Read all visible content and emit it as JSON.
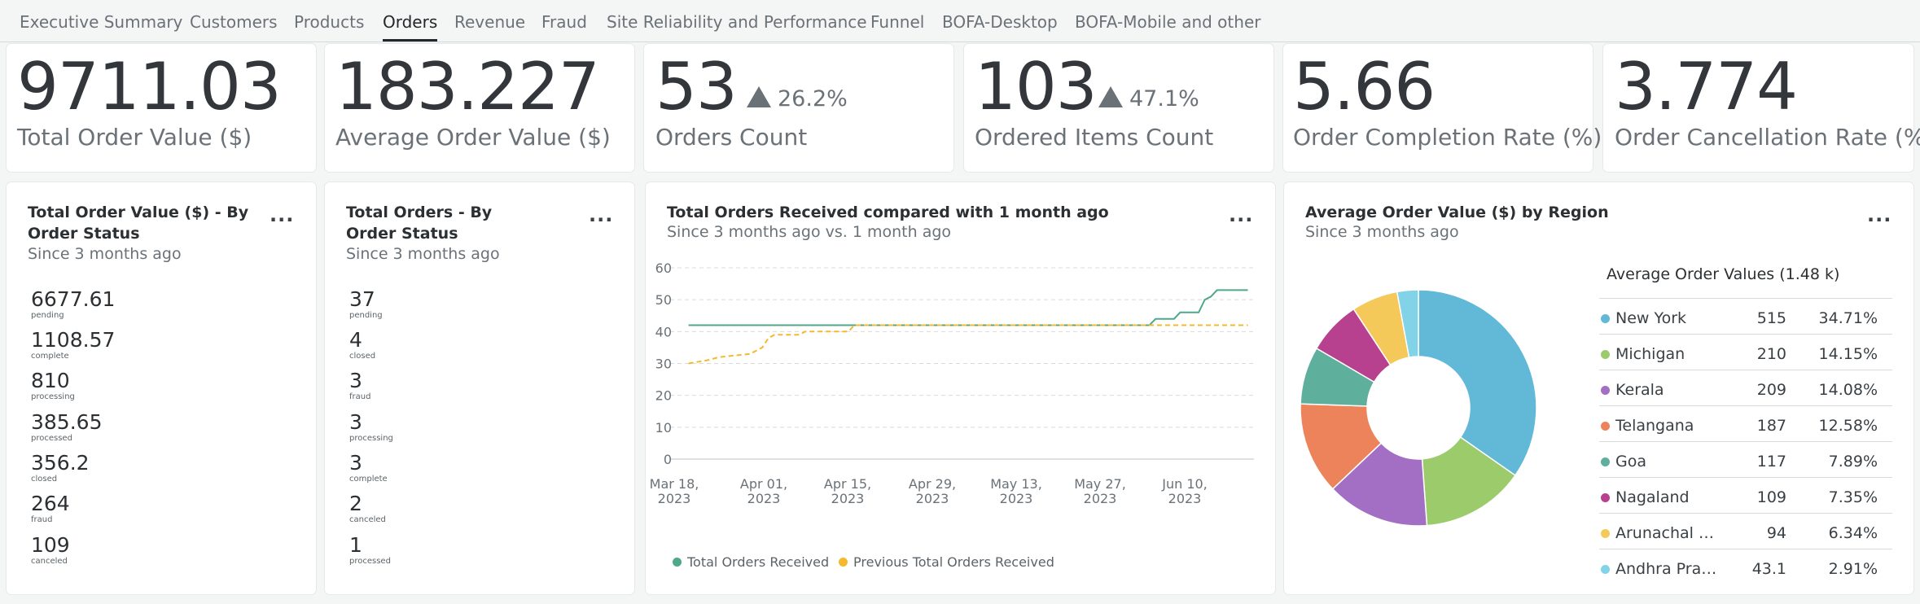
{
  "tabs": [
    {
      "label": "Executive Summary",
      "active": false
    },
    {
      "label": "Customers",
      "active": false
    },
    {
      "label": "Products",
      "active": false
    },
    {
      "label": "Orders",
      "active": true
    },
    {
      "label": "Revenue",
      "active": false
    },
    {
      "label": "Fraud",
      "active": false
    },
    {
      "label": "Site Reliability and Performance",
      "active": false
    },
    {
      "label": "Funnel",
      "active": false
    },
    {
      "label": "BOFA-Desktop",
      "active": false
    },
    {
      "label": "BOFA-Mobile and other",
      "active": false
    }
  ],
  "kpis": [
    {
      "value": "9711.03",
      "label": "Total Order Value ($)",
      "delta": ""
    },
    {
      "value": "183.227",
      "label": "Average Order Value ($)",
      "delta": ""
    },
    {
      "value": "53",
      "label": "Orders Count",
      "delta": "26.2%"
    },
    {
      "value": "103",
      "label": "Ordered Items Count",
      "delta": "47.1%"
    },
    {
      "value": "5.66",
      "label": "Order Completion Rate (%)",
      "delta": ""
    },
    {
      "value": "3.774",
      "label": "Order Cancellation Rate (%)",
      "delta": ""
    }
  ],
  "panels": {
    "order_value_status": {
      "title": "Total Order Value ($) - By Order Status",
      "subtitle": "Since 3 months ago",
      "menu": "...",
      "stats": [
        {
          "value": "6677.61",
          "label": "pending"
        },
        {
          "value": "1108.57",
          "label": "complete"
        },
        {
          "value": "810",
          "label": "processing"
        },
        {
          "value": "385.65",
          "label": "processed"
        },
        {
          "value": "356.2",
          "label": "closed"
        },
        {
          "value": "264",
          "label": "fraud"
        },
        {
          "value": "109",
          "label": "canceled"
        }
      ]
    },
    "orders_status": {
      "title": "Total Orders - By Order Status",
      "subtitle": "Since 3 months ago",
      "menu": "...",
      "stats": [
        {
          "value": "37",
          "label": "pending"
        },
        {
          "value": "4",
          "label": "closed"
        },
        {
          "value": "3",
          "label": "fraud"
        },
        {
          "value": "3",
          "label": "processing"
        },
        {
          "value": "3",
          "label": "complete"
        },
        {
          "value": "2",
          "label": "canceled"
        },
        {
          "value": "1",
          "label": "processed"
        }
      ]
    },
    "orders_compare": {
      "title": "Total Orders Received compared with 1 month ago",
      "subtitle": "Since 3 months ago vs. 1 month ago",
      "menu": "..."
    },
    "region": {
      "title": "Average Order Value ($) by Region",
      "subtitle": "Since 3 months ago",
      "menu": "...",
      "table_title": "Average Order Values (1.48 k)",
      "rows": [
        {
          "name": "New York",
          "value": "515",
          "pct": "34.71%",
          "color": "#62b8d7"
        },
        {
          "name": "Michigan",
          "value": "210",
          "pct": "14.15%",
          "color": "#9ccb6b"
        },
        {
          "name": "Kerala",
          "value": "209",
          "pct": "14.08%",
          "color": "#a36fc4"
        },
        {
          "name": "Telangana",
          "value": "187",
          "pct": "12.58%",
          "color": "#ec835b"
        },
        {
          "name": "Goa",
          "value": "117",
          "pct": "7.89%",
          "color": "#5eaf9b"
        },
        {
          "name": "Nagaland",
          "value": "109",
          "pct": "7.35%",
          "color": "#b8418f"
        },
        {
          "name": "Arunachal Pr...",
          "value": "94",
          "pct": "6.34%",
          "color": "#f4c95a"
        },
        {
          "name": "Andhra Prad...",
          "value": "43.1",
          "pct": "2.91%",
          "color": "#82d2e8"
        }
      ]
    }
  },
  "chart_data": [
    {
      "type": "line",
      "title": "Total Orders Received compared with 1 month ago",
      "ylim": [
        0,
        60
      ],
      "y_ticks": [
        "60",
        "50",
        "40",
        "30",
        "20",
        "10",
        "0"
      ],
      "x_ticks": [
        {
          "l1": "Mar 18,",
          "l2": "2023"
        },
        {
          "l1": "Apr 01,",
          "l2": "2023"
        },
        {
          "l1": "Apr 15,",
          "l2": "2023"
        },
        {
          "l1": "Apr 29,",
          "l2": "2023"
        },
        {
          "l1": "May 13,",
          "l2": "2023"
        },
        {
          "l1": "May 27,",
          "l2": "2023"
        },
        {
          "l1": "Jun 10,",
          "l2": "2023"
        }
      ],
      "x_ticks_printed": [
        "lar 18, 2023",
        "Apr 01, 2023",
        "Apr 15, 2023",
        "Apr 29, 2023",
        "May 13, 2023",
        "May 27, 2023",
        "Jun 10, 2023"
      ],
      "x_range": [
        "2023-03-18",
        "2023-06-21"
      ],
      "grid": true,
      "legend_position": "bottom-left",
      "series": [
        {
          "name": "Total Orders Received",
          "color": "#4fa88c",
          "dash": false,
          "points": [
            [
              "2023-03-21",
              42
            ],
            [
              "2023-06-04",
              42
            ],
            [
              "2023-06-05",
              44
            ],
            [
              "2023-06-08",
              44
            ],
            [
              "2023-06-09",
              46
            ],
            [
              "2023-06-12",
              46
            ],
            [
              "2023-06-13",
              50
            ],
            [
              "2023-06-14",
              51
            ],
            [
              "2023-06-15",
              53
            ],
            [
              "2023-06-20",
              53
            ]
          ]
        },
        {
          "name": "Previous Total Orders Received",
          "color": "#f4b92e",
          "dash": true,
          "points": [
            [
              "2023-03-21",
              30
            ],
            [
              "2023-03-24",
              31
            ],
            [
              "2023-03-26",
              32
            ],
            [
              "2023-03-31",
              33
            ],
            [
              "2023-04-02",
              35
            ],
            [
              "2023-04-03",
              38
            ],
            [
              "2023-04-04",
              39
            ],
            [
              "2023-04-08",
              39
            ],
            [
              "2023-04-09",
              40
            ],
            [
              "2023-04-16",
              40
            ],
            [
              "2023-04-17",
              42
            ],
            [
              "2023-06-20",
              42
            ]
          ]
        }
      ]
    },
    {
      "type": "pie",
      "title": "Average Order Value ($) by Region",
      "donut": true,
      "slices": [
        {
          "name": "New York",
          "value": 515,
          "color": "#62b8d7"
        },
        {
          "name": "Michigan",
          "value": 210,
          "color": "#9ccb6b"
        },
        {
          "name": "Kerala",
          "value": 209,
          "color": "#a36fc4"
        },
        {
          "name": "Telangana",
          "value": 187,
          "color": "#ec835b"
        },
        {
          "name": "Goa",
          "value": 117,
          "color": "#5eaf9b"
        },
        {
          "name": "Nagaland",
          "value": 109,
          "color": "#b8418f"
        },
        {
          "name": "Arunachal Pr...",
          "value": 94,
          "color": "#f4c95a"
        },
        {
          "name": "Andhra Prad...",
          "value": 43.1,
          "color": "#82d2e8"
        }
      ]
    }
  ]
}
